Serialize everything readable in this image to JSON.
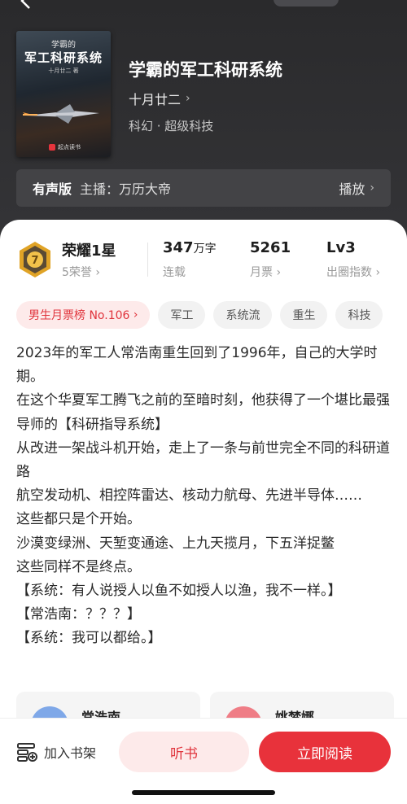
{
  "book": {
    "title": "学霸的军工科研系统",
    "author": "十月廿二",
    "genre": "科幻 · 超级科技",
    "cover": {
      "small_text": "学霸的",
      "big_text": "军工科研系统",
      "author_text": "十月廿二 著",
      "publisher": "起点读书"
    }
  },
  "audio": {
    "tag": "有声版",
    "host": "主播：万历大帝",
    "play": "播放"
  },
  "stats": {
    "honor": {
      "title": "荣耀1星",
      "sub": "5荣誉"
    },
    "words": {
      "value": "347",
      "unit": "万字",
      "sub": "连载"
    },
    "votes": {
      "value": "5261",
      "sub": "月票"
    },
    "level": {
      "value": "Lv3",
      "sub": "出圈指数"
    }
  },
  "tags": [
    "男生月票榜 No.106",
    "军工",
    "系统流",
    "重生",
    "科技"
  ],
  "description": [
    "2023年的军工人常浩南重生回到了1996年，自己的大学时期。",
    "在这个华夏军工腾飞之前的至暗时刻，他获得了一个堪比最强导师的【科研指导系统】",
    "从改进一架战斗机开始，走上了一条与前世完全不同的科研道路",
    "航空发动机、相控阵雷达、核动力航母、先进半导体……",
    "这些都只是个开始。",
    "沙漠变绿洲、天堑变通途、上九天揽月，下五洋捉鳖",
    "这些同样不是终点。",
    "【系统：有人说授人以鱼不如授人以渔，我不一样。】",
    "【常浩南：？？？】",
    "【系统：我可以都给。】"
  ],
  "characters": [
    {
      "name": "常浩南",
      "color": "#7fa8e8"
    },
    {
      "name": "姚梦娜",
      "color": "#ef7d86"
    }
  ],
  "bottom": {
    "shelf": "加入书架",
    "listen": "听书",
    "read": "立即阅读"
  },
  "colors": {
    "accent": "#e8323b",
    "accent_soft": "#fdeaea",
    "header_bg": "#2f2f31"
  }
}
